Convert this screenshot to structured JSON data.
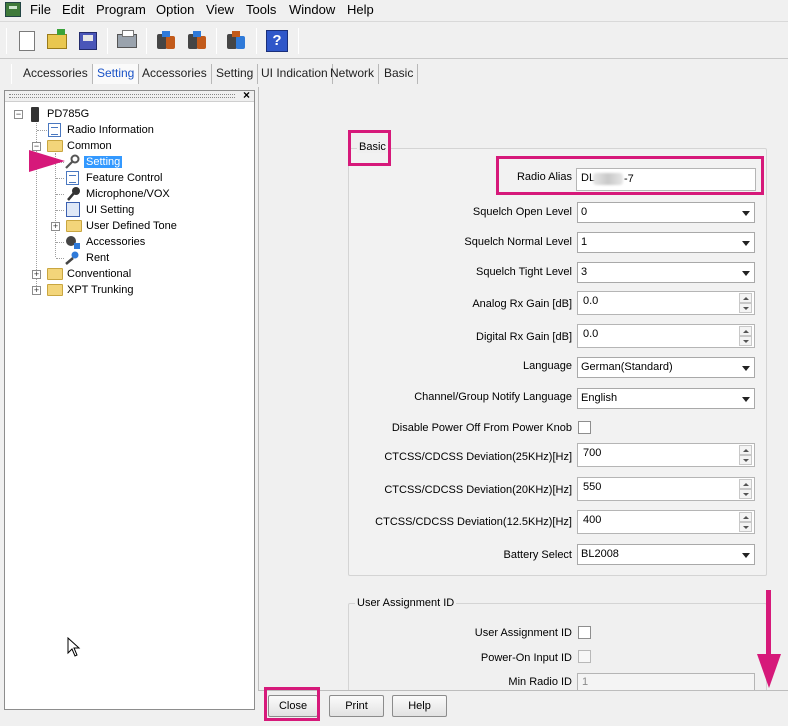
{
  "menubar": {
    "items": [
      "File",
      "Edit",
      "Program",
      "Option",
      "View",
      "Tools",
      "Window",
      "Help"
    ]
  },
  "toolbar": {
    "icons": [
      "new-file-icon",
      "open-folder-icon",
      "save-icon",
      "print-icon",
      "read-from-radio-icon",
      "write-to-radio-icon",
      "clone-icon",
      "help-icon"
    ],
    "help_glyph": "?"
  },
  "tabs": [
    "Accessories",
    "Setting",
    "Accessories",
    "Setting",
    "UI Indication",
    "Network",
    "Basic"
  ],
  "tree": {
    "close_glyph": "×",
    "root": "PD785G",
    "radio_information": "Radio Information",
    "common": "Common",
    "setting": "Setting",
    "feature_control": "Feature Control",
    "microphone_vox": "Microphone/VOX",
    "ui_setting": "UI Setting",
    "user_defined_tone": "User Defined Tone",
    "accessories": "Accessories",
    "rent": "Rent",
    "conventional": "Conventional",
    "xpt_trunking": "XPT Trunking"
  },
  "basic": {
    "title": "Basic",
    "radio_alias_label": "Radio Alias",
    "radio_alias_prefix": "DL",
    "radio_alias_suffix": "-7",
    "squelch_open_label": "Squelch Open Level",
    "squelch_open_value": "0",
    "squelch_normal_label": "Squelch Normal Level",
    "squelch_normal_value": "1",
    "squelch_tight_label": "Squelch Tight Level",
    "squelch_tight_value": "3",
    "analog_rx_gain_label": "Analog Rx Gain [dB]",
    "analog_rx_gain_value": "0.0",
    "digital_rx_gain_label": "Digital Rx Gain [dB]",
    "digital_rx_gain_value": "0.0",
    "language_label": "Language",
    "language_value": "German(Standard)",
    "notify_language_label": "Channel/Group Notify Language",
    "notify_language_value": "English",
    "disable_power_off_label": "Disable Power Off From Power Knob",
    "ctcss_25_label": "CTCSS/CDCSS Deviation(25KHz)[Hz]",
    "ctcss_25_value": "700",
    "ctcss_20_label": "CTCSS/CDCSS Deviation(20KHz)[Hz]",
    "ctcss_20_value": "550",
    "ctcss_125_label": "CTCSS/CDCSS Deviation(12.5KHz)[Hz]",
    "ctcss_125_value": "400",
    "battery_label": "Battery Select",
    "battery_value": "BL2008"
  },
  "user_assignment": {
    "title": "User Assignment ID",
    "user_assignment_id_label": "User Assignment ID",
    "power_on_input_label": "Power-On Input ID",
    "min_radio_id_label": "Min Radio ID",
    "min_radio_id_value": "1"
  },
  "buttons": {
    "close": "Close",
    "print": "Print",
    "help": "Help"
  },
  "colors": {
    "highlight": "#d6197a",
    "selection": "#3399ff",
    "active_tab": "#1a53c7"
  }
}
